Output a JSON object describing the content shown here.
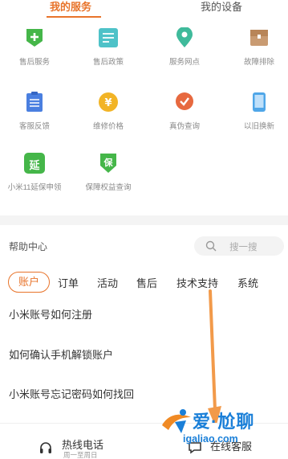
{
  "tabs": {
    "service": "我的服务",
    "device": "我的设备"
  },
  "services": [
    {
      "label": "售后服务",
      "icon": "shield-plus-icon",
      "color": "#45b649"
    },
    {
      "label": "售后政策",
      "icon": "document-list-icon",
      "color": "#4ec2c8"
    },
    {
      "label": "服务网点",
      "icon": "location-pin-icon",
      "color": "#3fba9b"
    },
    {
      "label": "故障排除",
      "icon": "toolbox-icon",
      "color": "#c99b72"
    },
    {
      "label": "客服反馈",
      "icon": "clipboard-icon",
      "color": "#4a7fe0"
    },
    {
      "label": "维修价格",
      "icon": "yuan-coin-icon",
      "color": "#f2b426"
    },
    {
      "label": "真伪查询",
      "icon": "badge-check-icon",
      "color": "#e7693f"
    },
    {
      "label": "以旧换新",
      "icon": "phone-icon",
      "color": "#4fa6e8"
    },
    {
      "label": "小米11延保申领",
      "icon": "extend-warranty-icon",
      "color": "#45b649",
      "glyph": "延"
    },
    {
      "label": "保障权益查询",
      "icon": "shield-coin-icon",
      "color": "#45b649",
      "glyph": "保"
    }
  ],
  "help": {
    "title": "帮助中心",
    "search_placeholder": "搜一搜",
    "categories": [
      "账户",
      "订单",
      "活动",
      "售后",
      "技术支持",
      "系统"
    ],
    "active_category": "账户",
    "questions": [
      "小米账号如何注册",
      "如何确认手机解锁账户",
      "小米账号忘记密码如何找回"
    ]
  },
  "bottom": {
    "hotline_label": "热线电话",
    "hotline_sub": "周一至周日",
    "chat_label": "在线客服"
  },
  "watermark": {
    "title": "爱·尬聊",
    "url": "igaliao.com"
  },
  "colors": {
    "accent": "#e8742b",
    "watermark": "#1a7fd8"
  }
}
